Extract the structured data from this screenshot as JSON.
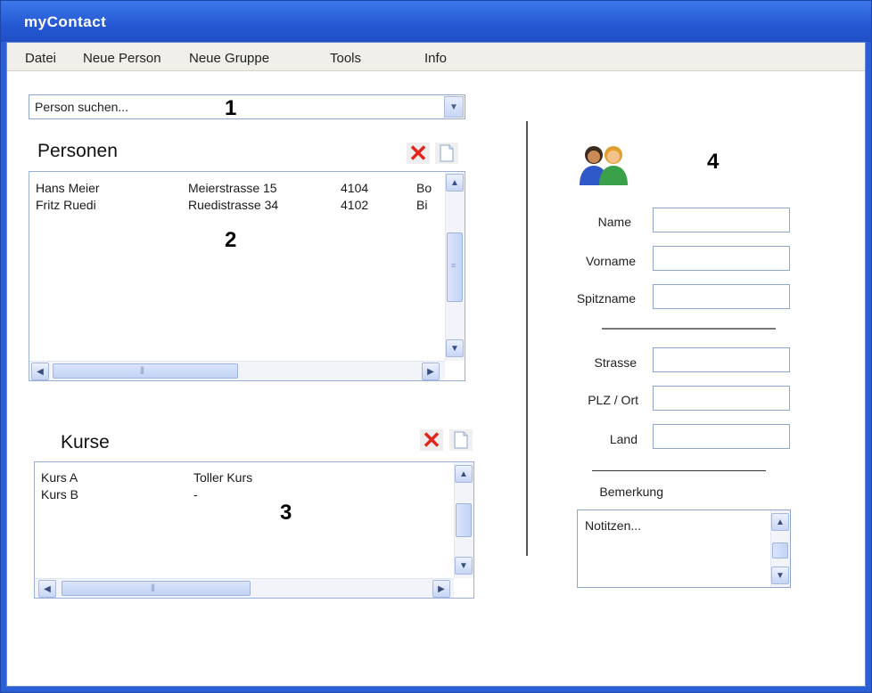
{
  "window": {
    "title": "myContact"
  },
  "menu": {
    "items": [
      "Datei",
      "Neue Person",
      "Neue Gruppe",
      "Tools",
      "Info"
    ]
  },
  "search": {
    "placeholder": "Person suchen..."
  },
  "annotations": {
    "one": "1",
    "two": "2",
    "three": "3",
    "four": "4"
  },
  "personen": {
    "title": "Personen",
    "rows": [
      {
        "name": "Hans Meier",
        "street": "Meierstrasse 15",
        "plz": "4104",
        "ort": "Bo"
      },
      {
        "name": "Fritz Ruedi",
        "street": "Ruedistrasse 34",
        "plz": "4102",
        "ort": "Bi"
      }
    ]
  },
  "kurse": {
    "title": "Kurse",
    "rows": [
      {
        "name": "Kurs A",
        "desc": "Toller Kurs"
      },
      {
        "name": "Kurs B",
        "desc": "-"
      }
    ]
  },
  "form": {
    "name_label": "Name",
    "vorname_label": "Vorname",
    "spitzname_label": "Spitzname",
    "strasse_label": "Strasse",
    "plzort_label": "PLZ / Ort",
    "land_label": "Land",
    "bemerkung_label": "Bemerkung",
    "notes_placeholder": "Notitzen..."
  },
  "icons": {
    "delete": "close-x-icon",
    "new": "new-document-icon",
    "contacts": "contacts-people-icon",
    "scroll_up": "chevron-up-icon",
    "scroll_down": "chevron-down-icon",
    "scroll_left": "chevron-left-icon",
    "scroll_right": "chevron-right-icon"
  },
  "colors": {
    "titlebar": "#2558d2",
    "delete_red": "#e3261b",
    "window_border": "#2a5fd6"
  }
}
